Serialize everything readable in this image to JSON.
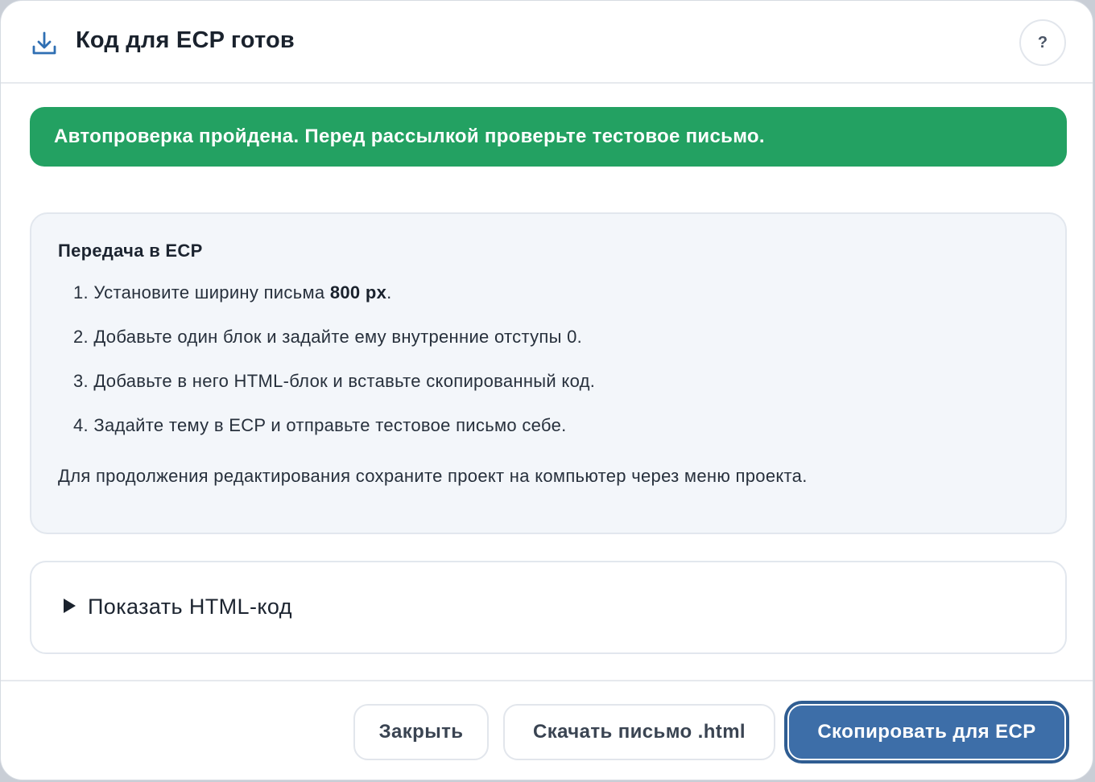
{
  "dialog": {
    "title": "Код для ECP готов",
    "header_icon": "download-icon",
    "help_label": "?"
  },
  "banner": {
    "text": "Автопроверка пройдена. Перед рассылкой проверьте тестовое письмо.",
    "color": "#23a162"
  },
  "instructions": {
    "title": "Передача в ECP",
    "steps": [
      {
        "prefix": "1. Установите ширину письма ",
        "bold": "800 px",
        "suffix": "."
      },
      {
        "prefix": "2. Добавьте один блок и задайте ему внутренние отступы 0.",
        "bold": "",
        "suffix": ""
      },
      {
        "prefix": "3. Добавьте в него HTML-блок и вставьте скопированный код.",
        "bold": "",
        "suffix": ""
      },
      {
        "prefix": "4. Задайте тему в ECP и отправьте тестовое письмо себе.",
        "bold": "",
        "suffix": ""
      }
    ],
    "note": "Для продолжения редактирования сохраните проект на компьютер через меню проекта."
  },
  "code_toggle": {
    "label": "Показать HTML-код",
    "expanded": false
  },
  "footer": {
    "close_label": "Закрыть",
    "download_label": "Скачать письмо .html",
    "copy_label": "Скопировать для ECP",
    "primary_color": "#3d6ea8"
  }
}
